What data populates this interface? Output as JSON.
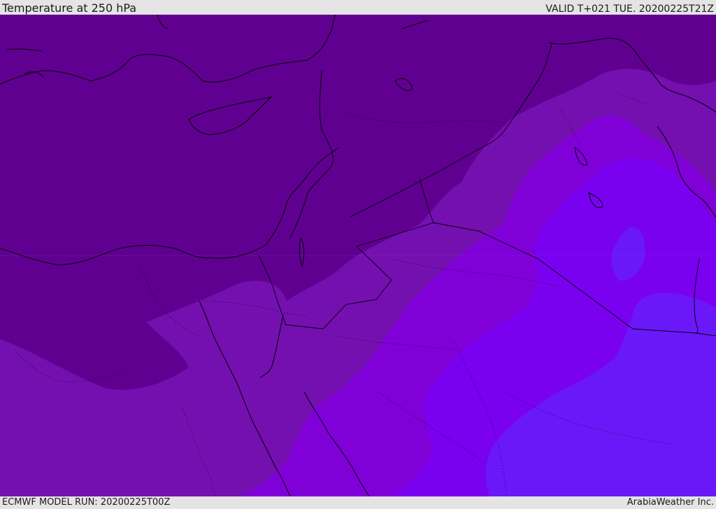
{
  "header": {
    "title": "Temperature at 250 hPa",
    "valid": "VALID T+021 TUE. 20200225T21Z"
  },
  "footer": {
    "model_run": "ECMWF MODEL RUN: 20200225T00Z",
    "credit": "ArabiaWeather Inc."
  },
  "map": {
    "variable": "Temperature at 250 hPa",
    "fill_colors": [
      "#600090",
      "#7410b0",
      "#8000d8",
      "#7a00f0",
      "#6a18f8"
    ],
    "border_color": "#000000"
  }
}
